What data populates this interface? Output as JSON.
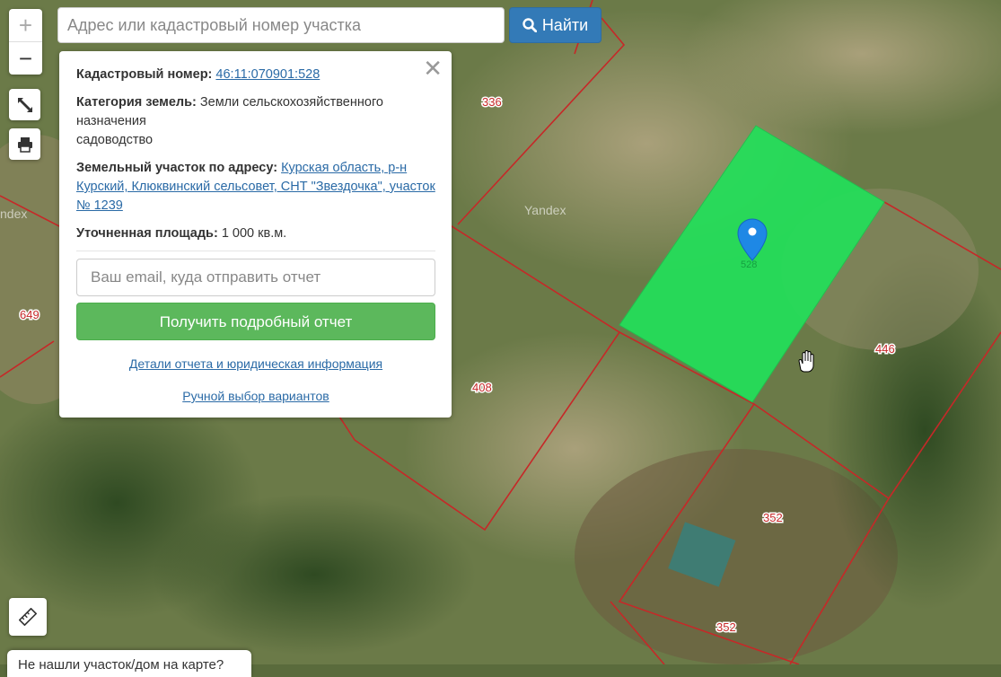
{
  "search": {
    "placeholder": "Адрес или кадастровый номер участка",
    "button_label": "Найти"
  },
  "zoom": {
    "in_label": "+",
    "out_label": "−"
  },
  "controls": [
    {
      "name": "fullscreen-button",
      "icon": "expand-icon"
    },
    {
      "name": "print-button",
      "icon": "printer-icon"
    },
    {
      "name": "ruler-button",
      "icon": "ruler-icon"
    }
  ],
  "info_panel": {
    "close_label": "✕",
    "cadastral_label": "Кадастровый номер:",
    "cadastral_value": "46:11:070901:528",
    "category_label": "Категория земель:",
    "category_value": "Земли сельскохозяйственного назначения",
    "category_use": "садоводство",
    "address_label": "Земельный участок по адресу:",
    "address_value": "Курская область, р-н Курский, Клюквинский сельсовет, СНТ \"Звездочка\", участок № 1239",
    "area_label": "Уточненная площадь:",
    "area_value": "1 000 кв.м.",
    "email_placeholder": "Ваш email, куда отправить отчет",
    "report_button": "Получить подробный отчет",
    "details_link": "Детали отчета и юридическая информация",
    "manual_link": "Ручной выбор вариантов"
  },
  "map": {
    "watermarks": [
      "Yandex",
      "ndex"
    ],
    "parcel_labels": [
      "336",
      "649",
      "408",
      "446",
      "352",
      "352",
      "528"
    ],
    "selected_color": "#22e05a",
    "boundary_color": "#c62828"
  },
  "bottom_tab": {
    "text": "Не нашли участок/дом на карте?"
  }
}
